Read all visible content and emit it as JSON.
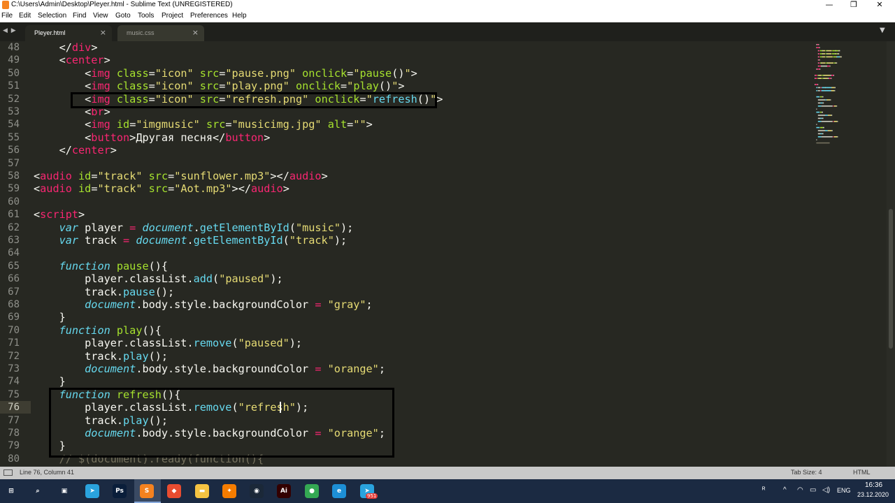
{
  "window": {
    "title": "C:\\Users\\Admin\\Desktop\\Pleyer.html - Sublime Text (UNREGISTERED)",
    "min_glyph": "—",
    "max_glyph": "❐",
    "close_glyph": "✕"
  },
  "menu": [
    "File",
    "Edit",
    "Selection",
    "Find",
    "View",
    "Goto",
    "Tools",
    "Project",
    "Preferences",
    "Help"
  ],
  "tabs": [
    {
      "label": "Pleyer.html",
      "active": true
    },
    {
      "label": "music.css",
      "active": false
    }
  ],
  "tab_close_glyph": "×",
  "nav_arrows": "◀ ▶",
  "tab_dropdown_glyph": "▼",
  "line_numbers": [
    "48",
    "49",
    "50",
    "51",
    "52",
    "53",
    "54",
    "55",
    "56",
    "57",
    "58",
    "59",
    "60",
    "61",
    "62",
    "63",
    "64",
    "65",
    "66",
    "67",
    "68",
    "69",
    "70",
    "71",
    "72",
    "73",
    "74",
    "75",
    "76",
    "77",
    "78",
    "79",
    "80"
  ],
  "active_line": "76",
  "code": [
    [
      [
        "w",
        "    </"
      ],
      [
        "t",
        "div"
      ],
      [
        "w",
        ">"
      ]
    ],
    [
      [
        "w",
        "    <"
      ],
      [
        "t",
        "center"
      ],
      [
        "w",
        ">"
      ]
    ],
    [
      [
        "w",
        "        <"
      ],
      [
        "t",
        "img"
      ],
      [
        "w",
        " "
      ],
      [
        "a",
        "class"
      ],
      [
        "w",
        "="
      ],
      [
        "s",
        "\"icon\""
      ],
      [
        "w",
        " "
      ],
      [
        "a",
        "src"
      ],
      [
        "w",
        "="
      ],
      [
        "s",
        "\"pause.png\""
      ],
      [
        "w",
        " "
      ],
      [
        "a",
        "onclick"
      ],
      [
        "w",
        "="
      ],
      [
        "s",
        "\""
      ],
      [
        "f",
        "pause"
      ],
      [
        "w",
        "()"
      ],
      [
        "s",
        "\""
      ],
      [
        "w",
        ">"
      ]
    ],
    [
      [
        "w",
        "        <"
      ],
      [
        "t",
        "img"
      ],
      [
        "w",
        " "
      ],
      [
        "a",
        "class"
      ],
      [
        "w",
        "="
      ],
      [
        "s",
        "\"icon\""
      ],
      [
        "w",
        " "
      ],
      [
        "a",
        "src"
      ],
      [
        "w",
        "="
      ],
      [
        "s",
        "\"play.png\""
      ],
      [
        "w",
        " "
      ],
      [
        "a",
        "onclick"
      ],
      [
        "w",
        "="
      ],
      [
        "s",
        "\""
      ],
      [
        "f",
        "play"
      ],
      [
        "w",
        "()"
      ],
      [
        "s",
        "\""
      ],
      [
        "w",
        ">"
      ]
    ],
    [
      [
        "w",
        "        <"
      ],
      [
        "t",
        "img"
      ],
      [
        "w",
        " "
      ],
      [
        "a",
        "class"
      ],
      [
        "w",
        "="
      ],
      [
        "s",
        "\"icon\""
      ],
      [
        "w",
        " "
      ],
      [
        "a",
        "src"
      ],
      [
        "w",
        "="
      ],
      [
        "s",
        "\"refresh.png\""
      ],
      [
        "w",
        " "
      ],
      [
        "a",
        "onclick"
      ],
      [
        "w",
        "="
      ],
      [
        "s",
        "\""
      ],
      [
        "m",
        "refresh"
      ],
      [
        "w",
        "()"
      ],
      [
        "s",
        "\""
      ],
      [
        "w",
        ">"
      ]
    ],
    [
      [
        "w",
        "        <"
      ],
      [
        "t",
        "br"
      ],
      [
        "w",
        ">"
      ]
    ],
    [
      [
        "w",
        "        <"
      ],
      [
        "t",
        "img"
      ],
      [
        "w",
        " "
      ],
      [
        "a",
        "id"
      ],
      [
        "w",
        "="
      ],
      [
        "s",
        "\"imgmusic\""
      ],
      [
        "w",
        " "
      ],
      [
        "a",
        "src"
      ],
      [
        "w",
        "="
      ],
      [
        "s",
        "\"musicimg.jpg\""
      ],
      [
        "w",
        " "
      ],
      [
        "a",
        "alt"
      ],
      [
        "w",
        "="
      ],
      [
        "s",
        "\"\""
      ],
      [
        "w",
        ">"
      ]
    ],
    [
      [
        "w",
        "        <"
      ],
      [
        "t",
        "button"
      ],
      [
        "w",
        ">Другая песня</"
      ],
      [
        "t",
        "button"
      ],
      [
        "w",
        ">"
      ]
    ],
    [
      [
        "w",
        "    </"
      ],
      [
        "t",
        "center"
      ],
      [
        "w",
        ">"
      ]
    ],
    [],
    [
      [
        "w",
        "<"
      ],
      [
        "t",
        "audio"
      ],
      [
        "w",
        " "
      ],
      [
        "a",
        "id"
      ],
      [
        "w",
        "="
      ],
      [
        "s",
        "\"track\""
      ],
      [
        "w",
        " "
      ],
      [
        "a",
        "src"
      ],
      [
        "w",
        "="
      ],
      [
        "s",
        "\"sunflower.mp3\""
      ],
      [
        "w",
        "></"
      ],
      [
        "t",
        "audio"
      ],
      [
        "w",
        ">"
      ]
    ],
    [
      [
        "w",
        "<"
      ],
      [
        "t",
        "audio"
      ],
      [
        "w",
        " "
      ],
      [
        "a",
        "id"
      ],
      [
        "w",
        "="
      ],
      [
        "s",
        "\"track\""
      ],
      [
        "w",
        " "
      ],
      [
        "a",
        "src"
      ],
      [
        "w",
        "="
      ],
      [
        "s",
        "\"Aot.mp3\""
      ],
      [
        "w",
        "></"
      ],
      [
        "t",
        "audio"
      ],
      [
        "w",
        ">"
      ]
    ],
    [],
    [
      [
        "w",
        "<"
      ],
      [
        "t",
        "script"
      ],
      [
        "w",
        ">"
      ]
    ],
    [
      [
        "w",
        "    "
      ],
      [
        "k",
        "var"
      ],
      [
        "w",
        " player "
      ],
      [
        "t",
        "="
      ],
      [
        "w",
        " "
      ],
      [
        "k",
        "document"
      ],
      [
        "w",
        "."
      ],
      [
        "m",
        "getElementById"
      ],
      [
        "w",
        "("
      ],
      [
        "s",
        "\"music\""
      ],
      [
        "w",
        ");"
      ]
    ],
    [
      [
        "w",
        "    "
      ],
      [
        "k",
        "var"
      ],
      [
        "w",
        " track "
      ],
      [
        "t",
        "="
      ],
      [
        "w",
        " "
      ],
      [
        "k",
        "document"
      ],
      [
        "w",
        "."
      ],
      [
        "m",
        "getElementById"
      ],
      [
        "w",
        "("
      ],
      [
        "s",
        "\"track\""
      ],
      [
        "w",
        ");"
      ]
    ],
    [],
    [
      [
        "w",
        "    "
      ],
      [
        "k",
        "function"
      ],
      [
        "w",
        " "
      ],
      [
        "f",
        "pause"
      ],
      [
        "w",
        "(){"
      ]
    ],
    [
      [
        "w",
        "        player.classList."
      ],
      [
        "m",
        "add"
      ],
      [
        "w",
        "("
      ],
      [
        "s",
        "\"paused\""
      ],
      [
        "w",
        ");"
      ]
    ],
    [
      [
        "w",
        "        track."
      ],
      [
        "m",
        "pause"
      ],
      [
        "w",
        "();"
      ]
    ],
    [
      [
        "w",
        "        "
      ],
      [
        "k",
        "document"
      ],
      [
        "w",
        ".body.style.backgroundColor "
      ],
      [
        "t",
        "="
      ],
      [
        "w",
        " "
      ],
      [
        "s",
        "\"gray\""
      ],
      [
        "w",
        ";"
      ]
    ],
    [
      [
        "w",
        "    }"
      ]
    ],
    [
      [
        "w",
        "    "
      ],
      [
        "k",
        "function"
      ],
      [
        "w",
        " "
      ],
      [
        "f",
        "play"
      ],
      [
        "w",
        "(){"
      ]
    ],
    [
      [
        "w",
        "        player.classList."
      ],
      [
        "m",
        "remove"
      ],
      [
        "w",
        "("
      ],
      [
        "s",
        "\"paused\""
      ],
      [
        "w",
        ");"
      ]
    ],
    [
      [
        "w",
        "        track."
      ],
      [
        "m",
        "play"
      ],
      [
        "w",
        "();"
      ]
    ],
    [
      [
        "w",
        "        "
      ],
      [
        "k",
        "document"
      ],
      [
        "w",
        ".body.style.backgroundColor "
      ],
      [
        "t",
        "="
      ],
      [
        "w",
        " "
      ],
      [
        "s",
        "\"orange\""
      ],
      [
        "w",
        ";"
      ]
    ],
    [
      [
        "w",
        "    }"
      ]
    ],
    [
      [
        "w",
        "    "
      ],
      [
        "k",
        "function"
      ],
      [
        "w",
        " "
      ],
      [
        "f",
        "refresh"
      ],
      [
        "w",
        "(){"
      ]
    ],
    [
      [
        "w",
        "        player.classList."
      ],
      [
        "m",
        "remove"
      ],
      [
        "w",
        "("
      ],
      [
        "s",
        "\"refresh\""
      ],
      [
        "w",
        ");"
      ]
    ],
    [
      [
        "w",
        "        track."
      ],
      [
        "m",
        "play"
      ],
      [
        "w",
        "();"
      ]
    ],
    [
      [
        "w",
        "        "
      ],
      [
        "k",
        "document"
      ],
      [
        "w",
        ".body.style.backgroundColor "
      ],
      [
        "t",
        "="
      ],
      [
        "w",
        " "
      ],
      [
        "s",
        "\"orange\""
      ],
      [
        "w",
        ";"
      ]
    ],
    [
      [
        "w",
        "    }"
      ]
    ],
    [
      [
        "c",
        "    // $(document).ready(function(){"
      ]
    ]
  ],
  "status": {
    "position": "Line 76, Column 41",
    "tab_size": "Tab Size: 4",
    "syntax": "HTML"
  },
  "taskbar": {
    "apps": [
      {
        "name": "windows-start-icon",
        "glyph": "⊞",
        "color": "#1b2a42"
      },
      {
        "name": "search-icon",
        "glyph": "⌕",
        "color": "#1b2a42"
      },
      {
        "name": "task-view-icon",
        "glyph": "▣",
        "color": "#1b2a42"
      },
      {
        "name": "telegram-icon",
        "glyph": "➤",
        "color": "#2aa3de"
      },
      {
        "name": "photoshop-icon",
        "glyph": "Ps",
        "color": "#0a1e3a"
      },
      {
        "name": "sublime-icon",
        "glyph": "S",
        "color": "#f5821f"
      },
      {
        "name": "brave-icon",
        "glyph": "◆",
        "color": "#e84c30"
      },
      {
        "name": "file-explorer-icon",
        "glyph": "▬",
        "color": "#f5c342"
      },
      {
        "name": "blender-icon",
        "glyph": "✦",
        "color": "#f57c00"
      },
      {
        "name": "steam-icon",
        "glyph": "◉",
        "color": "#1b2838"
      },
      {
        "name": "illustrator-icon",
        "glyph": "Ai",
        "color": "#330000"
      },
      {
        "name": "chrome-icon",
        "glyph": "●",
        "color": "#34a853"
      },
      {
        "name": "edge-icon",
        "glyph": "e",
        "color": "#1d8fd6"
      },
      {
        "name": "telegram-2-icon",
        "glyph": "➤",
        "color": "#2aa3de"
      }
    ],
    "badge": "951",
    "lang": "ENG",
    "time": "16:36",
    "date": "23.12.2020"
  },
  "colors": {
    "editor_bg": "#272822",
    "tag": "#f92672",
    "attr": "#a6e22e",
    "string": "#e6db74",
    "keyword": "#66d9ef",
    "text": "#f8f8f2"
  }
}
